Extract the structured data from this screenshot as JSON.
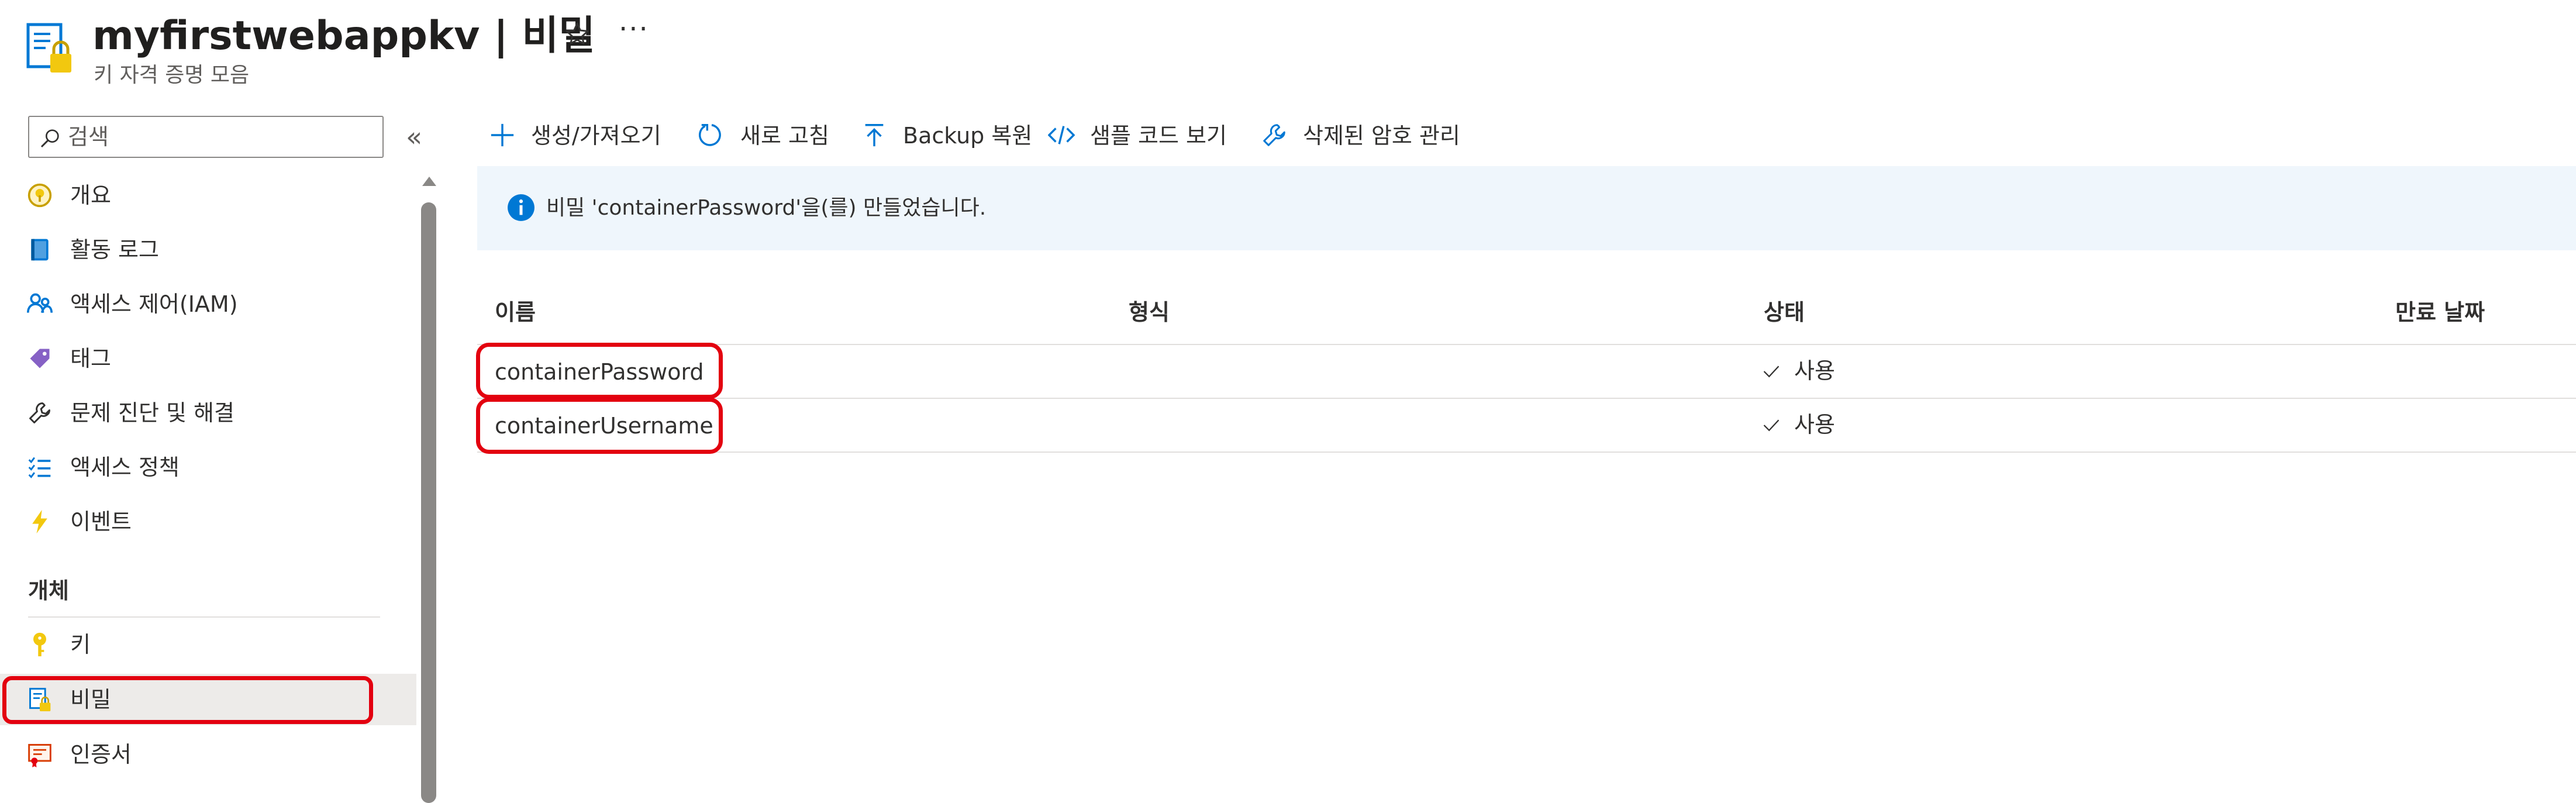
{
  "header": {
    "title": "myfirstwebappkv | 비밀",
    "subtitle": "키 자격 증명 모음",
    "more_label": "···"
  },
  "sidebar": {
    "search_placeholder": "검색",
    "collapse_label": "«",
    "items": [
      {
        "label": "개요",
        "icon": "overview-icon"
      },
      {
        "label": "활동 로그",
        "icon": "activity-log-icon"
      },
      {
        "label": "액세스 제어(IAM)",
        "icon": "iam-icon"
      },
      {
        "label": "태그",
        "icon": "tag-icon"
      },
      {
        "label": "문제 진단 및 해결",
        "icon": "wrench-icon"
      },
      {
        "label": "액세스 정책",
        "icon": "access-policy-icon"
      },
      {
        "label": "이벤트",
        "icon": "lightning-icon"
      }
    ],
    "section_label": "개체",
    "section_items": [
      {
        "label": "키",
        "icon": "key-icon"
      },
      {
        "label": "비밀",
        "icon": "secret-icon",
        "selected": true
      },
      {
        "label": "인증서",
        "icon": "certificate-icon"
      }
    ]
  },
  "toolbar": {
    "generate_import": "생성/가져오기",
    "refresh": "새로 고침",
    "backup_restore": "Backup 복원",
    "sample_code": "샘플 코드 보기",
    "manage_deleted": "삭제된 암호 관리"
  },
  "banner": {
    "message": "비밀 'containerPassword'을(를) 만들었습니다."
  },
  "table": {
    "columns": [
      "이름",
      "형식",
      "상태",
      "만료 날짜"
    ],
    "rows": [
      {
        "name": "containerPassword",
        "type": "",
        "status": "사용",
        "expiration": ""
      },
      {
        "name": "containerUsername",
        "type": "",
        "status": "사용",
        "expiration": ""
      }
    ]
  },
  "colors": {
    "accent": "#0078d4",
    "highlight_outline": "#e3000f",
    "banner_bg": "#eff6fc",
    "selected_bg": "#edebe9"
  }
}
